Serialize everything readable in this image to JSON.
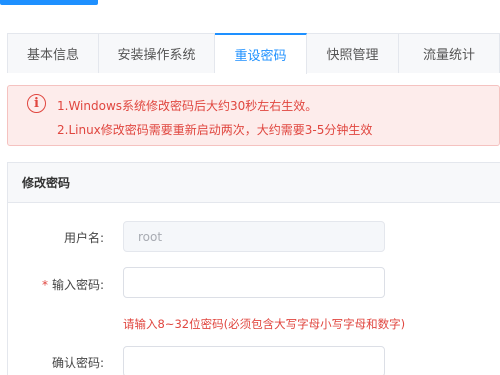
{
  "tabs": [
    {
      "label": "基本信息",
      "active": false
    },
    {
      "label": "安装操作系统",
      "active": false
    },
    {
      "label": "重设密码",
      "active": true
    },
    {
      "label": "快照管理",
      "active": false
    },
    {
      "label": "流量统计",
      "active": false
    }
  ],
  "alert": {
    "icon": "info-circle-icon",
    "line1": "1.Windows系统修改密码后大约30秒左右生效。",
    "line2": "2.Linux修改密码需要重新启动两次，大约需要3-5分钟生效"
  },
  "section": {
    "title": "修改密码"
  },
  "form": {
    "username_label": "用户名:",
    "username_value": "root",
    "password_required_mark": "*",
    "password_label": "输入密码:",
    "password_value": "",
    "password_hint": "请输入8~32位密码(必须包含大写字母小写字母和数字)",
    "confirm_label": "确认密码:",
    "confirm_value": ""
  },
  "colors": {
    "accent": "#1e90ff",
    "error": "#e0463f",
    "alert_bg": "#fdeceb"
  }
}
